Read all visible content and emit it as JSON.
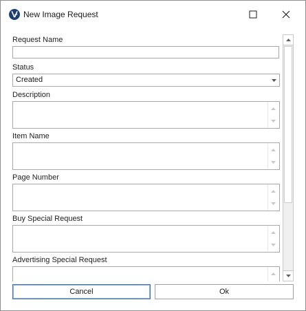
{
  "window": {
    "title": "New Image Request",
    "icon": "vine-logo-icon"
  },
  "form": {
    "request_name": {
      "label": "Request Name",
      "value": ""
    },
    "status": {
      "label": "Status",
      "value": "Created"
    },
    "description": {
      "label": "Description",
      "value": ""
    },
    "item_name": {
      "label": "Item Name",
      "value": ""
    },
    "page_number": {
      "label": "Page Number",
      "value": ""
    },
    "buy_special_request": {
      "label": "Buy Special Request",
      "value": ""
    },
    "advertising_special_request": {
      "label": "Advertising Special Request",
      "value": ""
    }
  },
  "buttons": {
    "cancel": "Cancel",
    "ok": "Ok"
  },
  "colors": {
    "accent": "#3d77b8",
    "border": "#a9a9a9",
    "icon_bg": "#1c3f73"
  }
}
